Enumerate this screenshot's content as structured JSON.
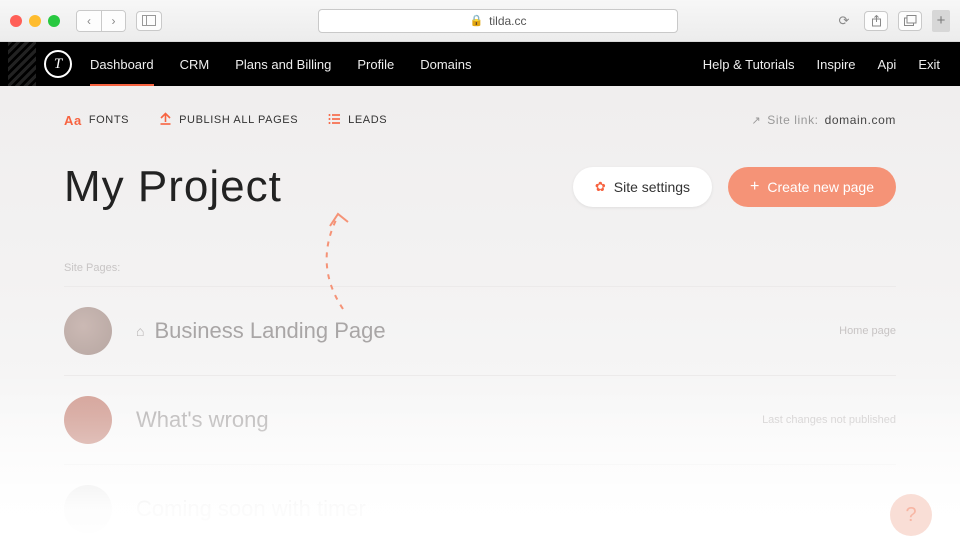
{
  "browser": {
    "address": "tilda.cc"
  },
  "topnav": {
    "items": [
      "Dashboard",
      "CRM",
      "Plans and Billing",
      "Profile",
      "Domains"
    ],
    "right": [
      "Help & Tutorials",
      "Inspire",
      "Api",
      "Exit"
    ]
  },
  "toolbar": {
    "fonts": {
      "icon": "Aa",
      "label": "FONTS"
    },
    "publish": {
      "label": "PUBLISH ALL PAGES"
    },
    "leads": {
      "label": "LEADS"
    },
    "sitelink_label": "Site link:",
    "sitelink_domain": "domain.com"
  },
  "project": {
    "title": "My Project",
    "settings_label": "Site settings",
    "create_label": "Create new page"
  },
  "pages": {
    "section_label": "Site Pages:",
    "items": [
      {
        "title": "Business Landing Page",
        "meta": "Home page",
        "has_home_icon": true
      },
      {
        "title": "What's wrong",
        "meta": "Last changes not published"
      },
      {
        "title": "Coming soon with timer",
        "meta": ""
      }
    ]
  },
  "help": {
    "glyph": "?"
  }
}
